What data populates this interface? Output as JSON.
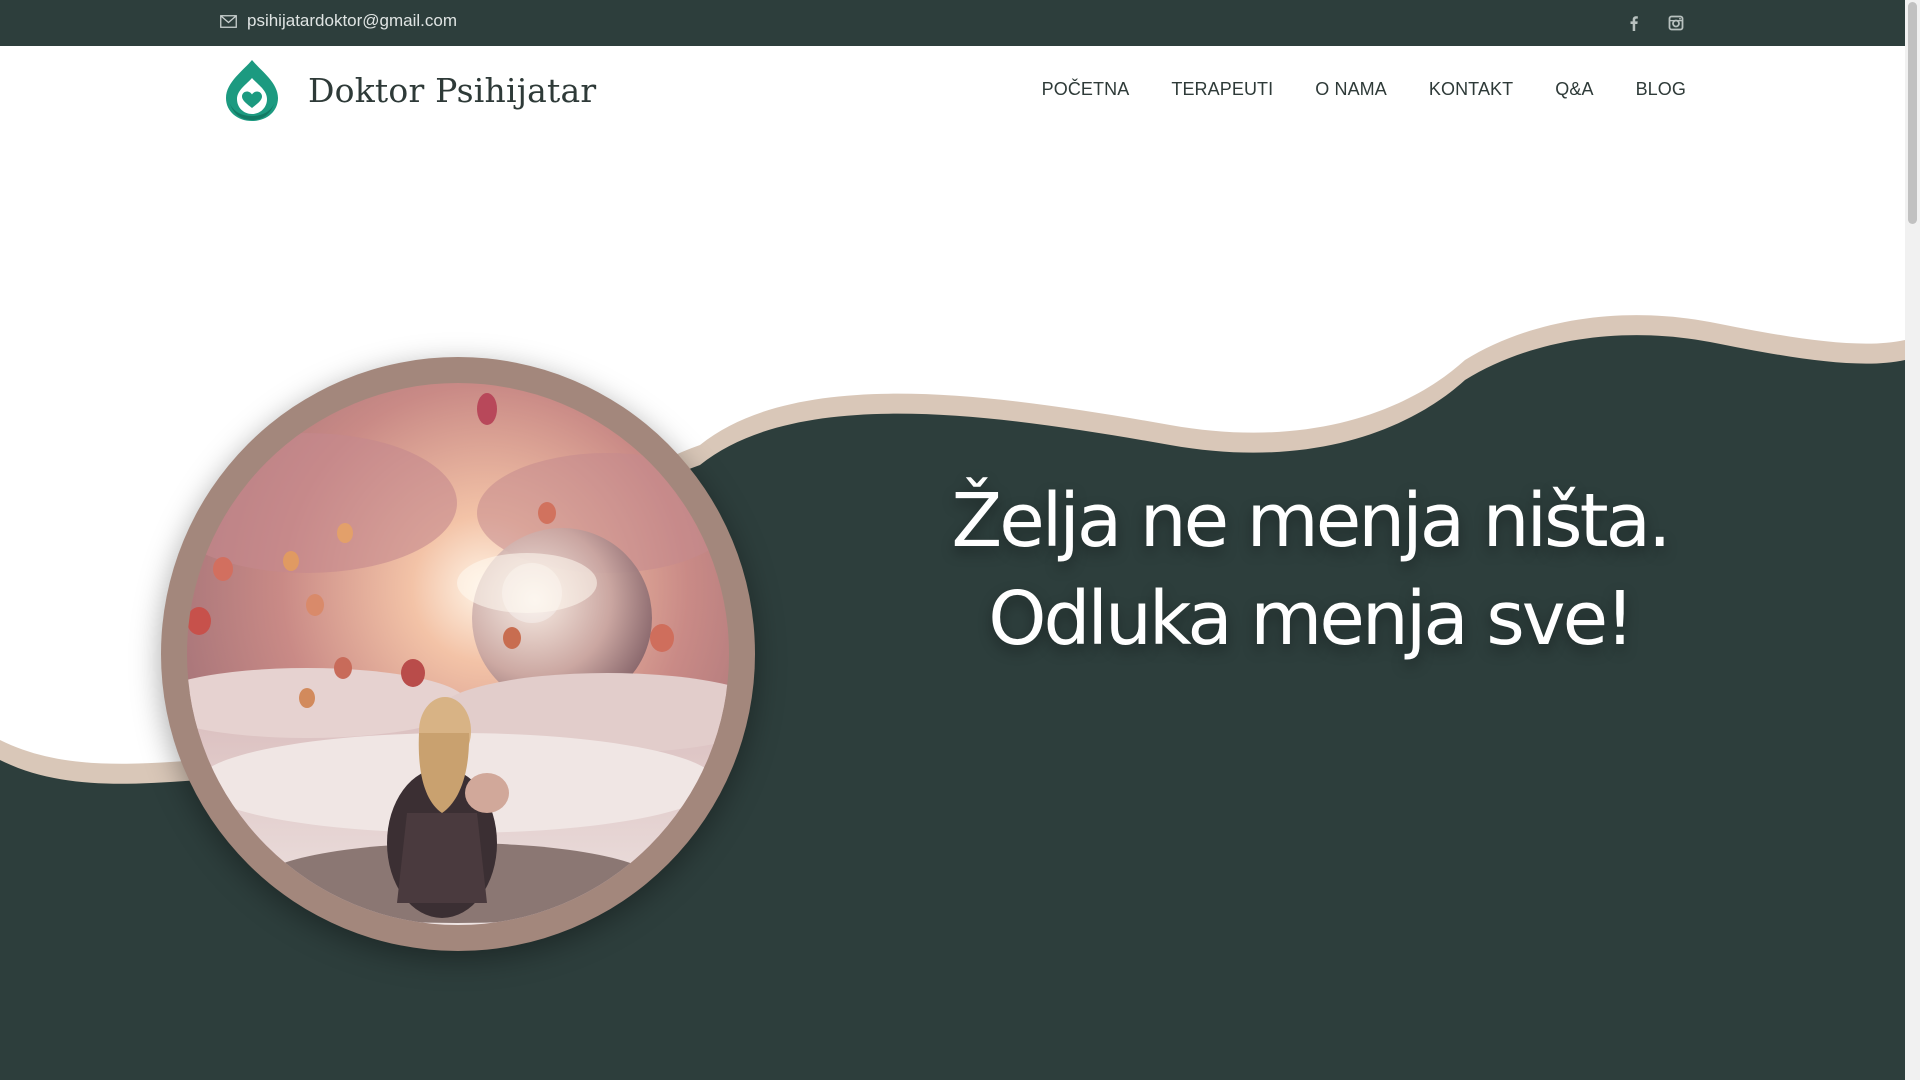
{
  "topbar": {
    "email": "psihijatardoktor@gmail.com",
    "social": [
      {
        "icon": "facebook-icon"
      },
      {
        "icon": "instagram-icon"
      }
    ]
  },
  "header": {
    "brand": "Doktor Psihijatar",
    "nav": [
      "POČETNA",
      "TERAPEUTI",
      "O NAMA",
      "KONTAKT",
      "Q&A",
      "BLOG"
    ]
  },
  "hero": {
    "line1": "Želja ne menja ništa.",
    "line2": "Odluka menja sve!",
    "image_description": "woman-above-clouds-with-balloons"
  },
  "colors": {
    "dark_green": "#2d3e3c",
    "accent_teal": "#1c9a80",
    "wave_beige": "#d9c7b8",
    "ring_brown": "#a3877c",
    "text_dark": "#2e3a38"
  }
}
